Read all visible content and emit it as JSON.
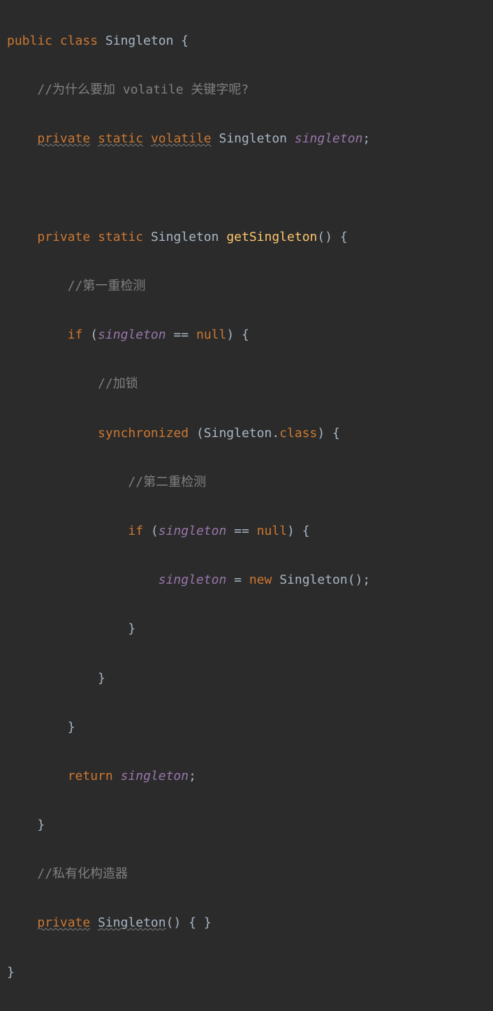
{
  "code": {
    "line1": {
      "kw_public": "public",
      "kw_class": "class",
      "class_name": "Singleton",
      "brace_open": "{"
    },
    "line2": {
      "comment": "//为什么要加 volatile 关键字呢?"
    },
    "line3": {
      "kw_private": "private",
      "kw_static": "static",
      "kw_volatile": "volatile",
      "type": "Singleton",
      "field": "singleton",
      "semi": ";"
    },
    "line5": {
      "kw_private": "private",
      "kw_static": "static",
      "ret_type": "Singleton",
      "method": "getSingleton",
      "parens": "()",
      "brace_open": "{"
    },
    "line6": {
      "comment": "//第一重检测"
    },
    "line7": {
      "kw_if": "if",
      "open_paren": "(",
      "field": "singleton",
      "op_eq": "==",
      "kw_null": "null",
      "close_paren": ")",
      "brace_open": "{"
    },
    "line8": {
      "comment": "//加锁"
    },
    "line9": {
      "kw_sync": "synchronized",
      "open_paren": "(",
      "class_ref": "Singleton",
      "dot": ".",
      "kw_class": "class",
      "close_paren": ")",
      "brace_open": "{"
    },
    "line10": {
      "comment": "//第二重检测"
    },
    "line11": {
      "kw_if": "if",
      "open_paren": "(",
      "field": "singleton",
      "op_eq": "==",
      "kw_null": "null",
      "close_paren": ")",
      "brace_open": "{"
    },
    "line12": {
      "field": "singleton",
      "op_assign": "=",
      "kw_new": "new",
      "ctor": "Singleton",
      "parens": "()",
      "semi": ";"
    },
    "line13": {
      "brace_close": "}"
    },
    "line14": {
      "brace_close": "}"
    },
    "line15": {
      "brace_close": "}"
    },
    "line16": {
      "kw_return": "return",
      "field": "singleton",
      "semi": ";"
    },
    "line17": {
      "brace_close": "}"
    },
    "line18": {
      "comment": "//私有化构造器"
    },
    "line19": {
      "kw_private": "private",
      "ctor": "Singleton",
      "parens": "()",
      "brace_open": "{",
      "brace_close": "}"
    },
    "line20": {
      "brace_close": "}"
    }
  }
}
